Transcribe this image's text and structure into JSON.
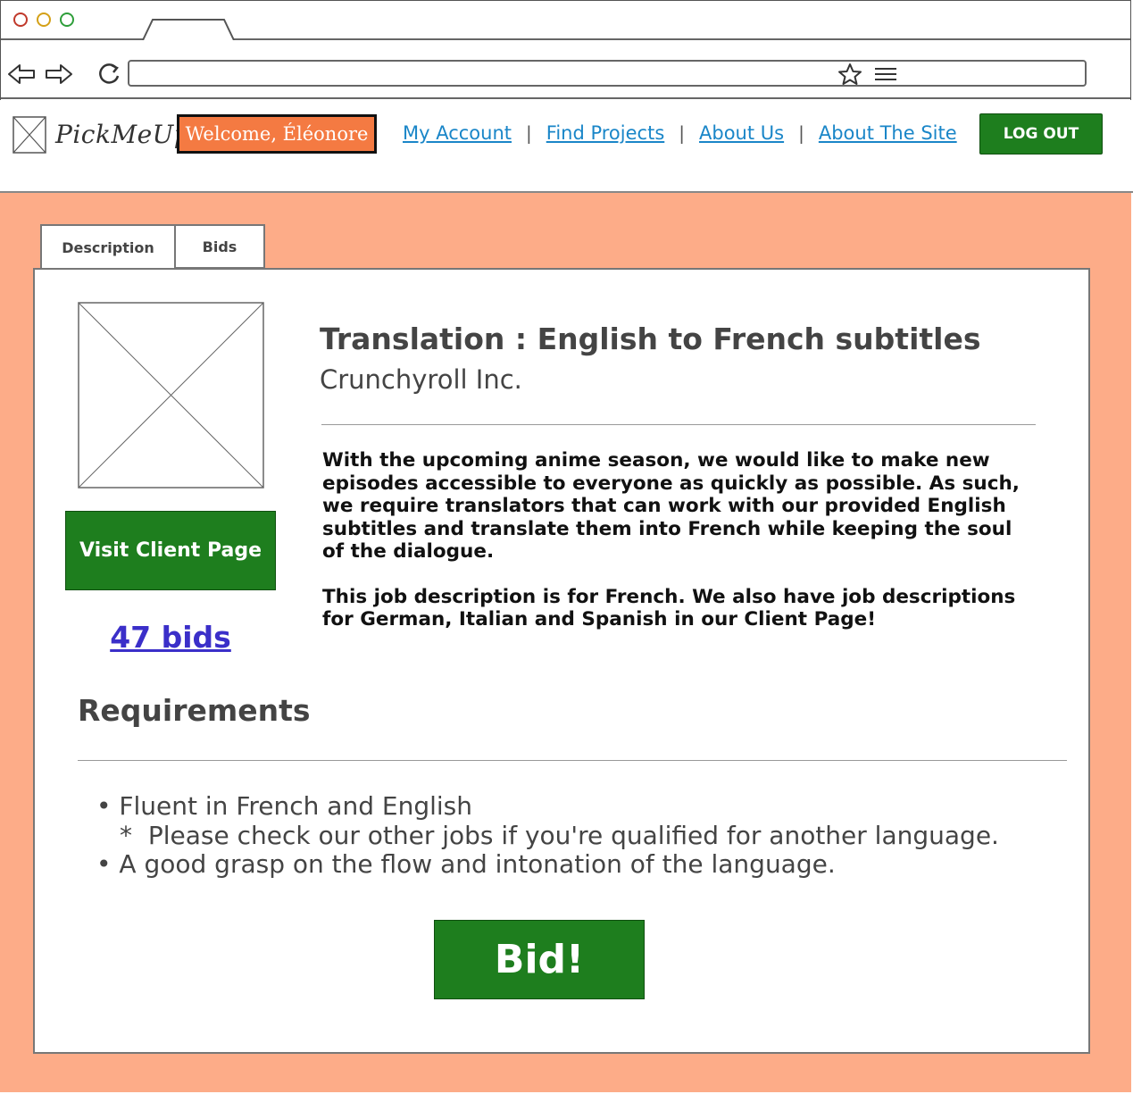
{
  "browser": {
    "controls": [
      "close",
      "minimize",
      "maximize"
    ],
    "nav_icons": [
      "back-arrow-icon",
      "forward-arrow-icon",
      "refresh-icon",
      "star-icon",
      "menu-icon"
    ]
  },
  "header": {
    "logo_text": "PickMeUp",
    "welcome": "Welcome, Éléonore",
    "links": [
      "My Account",
      "Find Projects",
      "About Us",
      "About The Site"
    ],
    "logout_label": "LOG OUT"
  },
  "tabs": [
    "Description",
    "Bids"
  ],
  "job": {
    "title": "Translation : English to French subtitles",
    "company": "Crunchyroll Inc.",
    "description": [
      "With the upcoming anime season, we would like to make new episodes accessible to everyone as quickly as possible. As such, we require translators that can work with our provided English subtitles and translate them into French while keeping the soul of the dialogue.",
      "This job description is for French. We also have job descriptions for German, Italian and Spanish in our Client Page!"
    ],
    "visit_client_label": "Visit Client Page",
    "bids_label": "47 bids"
  },
  "requirements": {
    "title": "Requirements",
    "item1": "Fluent in French and English",
    "item1_note": "Please check our other jobs if you're qualified for another language.",
    "item2": "A good grasp on the flow and intonation of the language."
  },
  "bid_label": "Bid!",
  "colors": {
    "accent_orange": "#f47a42",
    "page_background": "#fdac88",
    "button_green": "#1e7e1e",
    "link_blue": "#1a86c8",
    "bids_link": "#3b2fc9"
  }
}
